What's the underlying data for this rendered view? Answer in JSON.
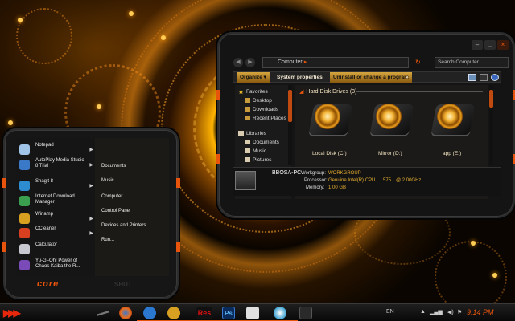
{
  "explorer": {
    "address": "Computer",
    "search_placeholder": "Search Computer",
    "toolbar": {
      "organize": "Organize",
      "system_properties": "System properties",
      "uninstall": "Uninstall or change a program",
      "more": "»"
    },
    "nav": {
      "favorites": "Favorites",
      "desktop": "Desktop",
      "downloads": "Downloads",
      "recent_places": "Recent Places",
      "libraries": "Libraries",
      "documents": "Documents",
      "music": "Music",
      "pictures": "Pictures"
    },
    "section_title": "Hard Disk Drives (3)",
    "drives": [
      {
        "label": "Local Disk (C:)"
      },
      {
        "label": "Mirror (D:)"
      },
      {
        "label": "app (E:)"
      }
    ],
    "details": {
      "pc_name": "BBOSA-PC",
      "workgroup_label": "Workgroup:",
      "workgroup": "WORKGROUP",
      "processor_label": "Processor:",
      "processor": "Genuine Intel(R) CPU",
      "processor_model": "575",
      "processor_speed": "@ 2.00GHz",
      "memory_label": "Memory:",
      "memory": "1.00 GB"
    }
  },
  "start_menu": {
    "programs": [
      {
        "label": "Notepad",
        "color": "#9fc4e8",
        "has_arrow": true
      },
      {
        "label": "AutoPlay Media Studio 8 Trial",
        "color": "#3a78c8",
        "has_arrow": true
      },
      {
        "label": "Snagit 8",
        "color": "#2d8cd0",
        "has_arrow": true
      },
      {
        "label": "Internet Download Manager",
        "color": "#3aa050",
        "has_arrow": false
      },
      {
        "label": "Winamp",
        "color": "#d8a020",
        "has_arrow": true
      },
      {
        "label": "CCleaner",
        "color": "#d84020",
        "has_arrow": true
      },
      {
        "label": "Calculator",
        "color": "#c8c8d0",
        "has_arrow": false
      },
      {
        "label": "Yu-Gi-Oh! Power of Chaos Kaiba the R...",
        "color": "#7a4ab8",
        "has_arrow": false
      }
    ],
    "places": [
      "Documents",
      "Music",
      "Computer",
      "Control Panel",
      "Devices and Printers",
      "Run..."
    ],
    "logo": "core",
    "shutdown": "SHUT"
  },
  "taskbar": {
    "apps": [
      {
        "name": "firefox-icon",
        "color": "#e87020"
      },
      {
        "name": "media-player-icon",
        "color": "#2a78d0"
      },
      {
        "name": "winamp-icon",
        "color": "#d8a020"
      },
      {
        "name": "reshacker-icon",
        "color": "#c01010"
      },
      {
        "name": "photoshop-icon",
        "color": "#1a5ab0"
      },
      {
        "name": "notepad-icon",
        "color": "#e0e0e0"
      },
      {
        "name": "globe-icon",
        "color": "#3aa0d0"
      }
    ],
    "res_text": "Res",
    "ps_text": "Ps",
    "language": "EN",
    "clock": "9:14 PM"
  },
  "colors": {
    "accent": "#e8540c",
    "gold": "#e8b030"
  }
}
